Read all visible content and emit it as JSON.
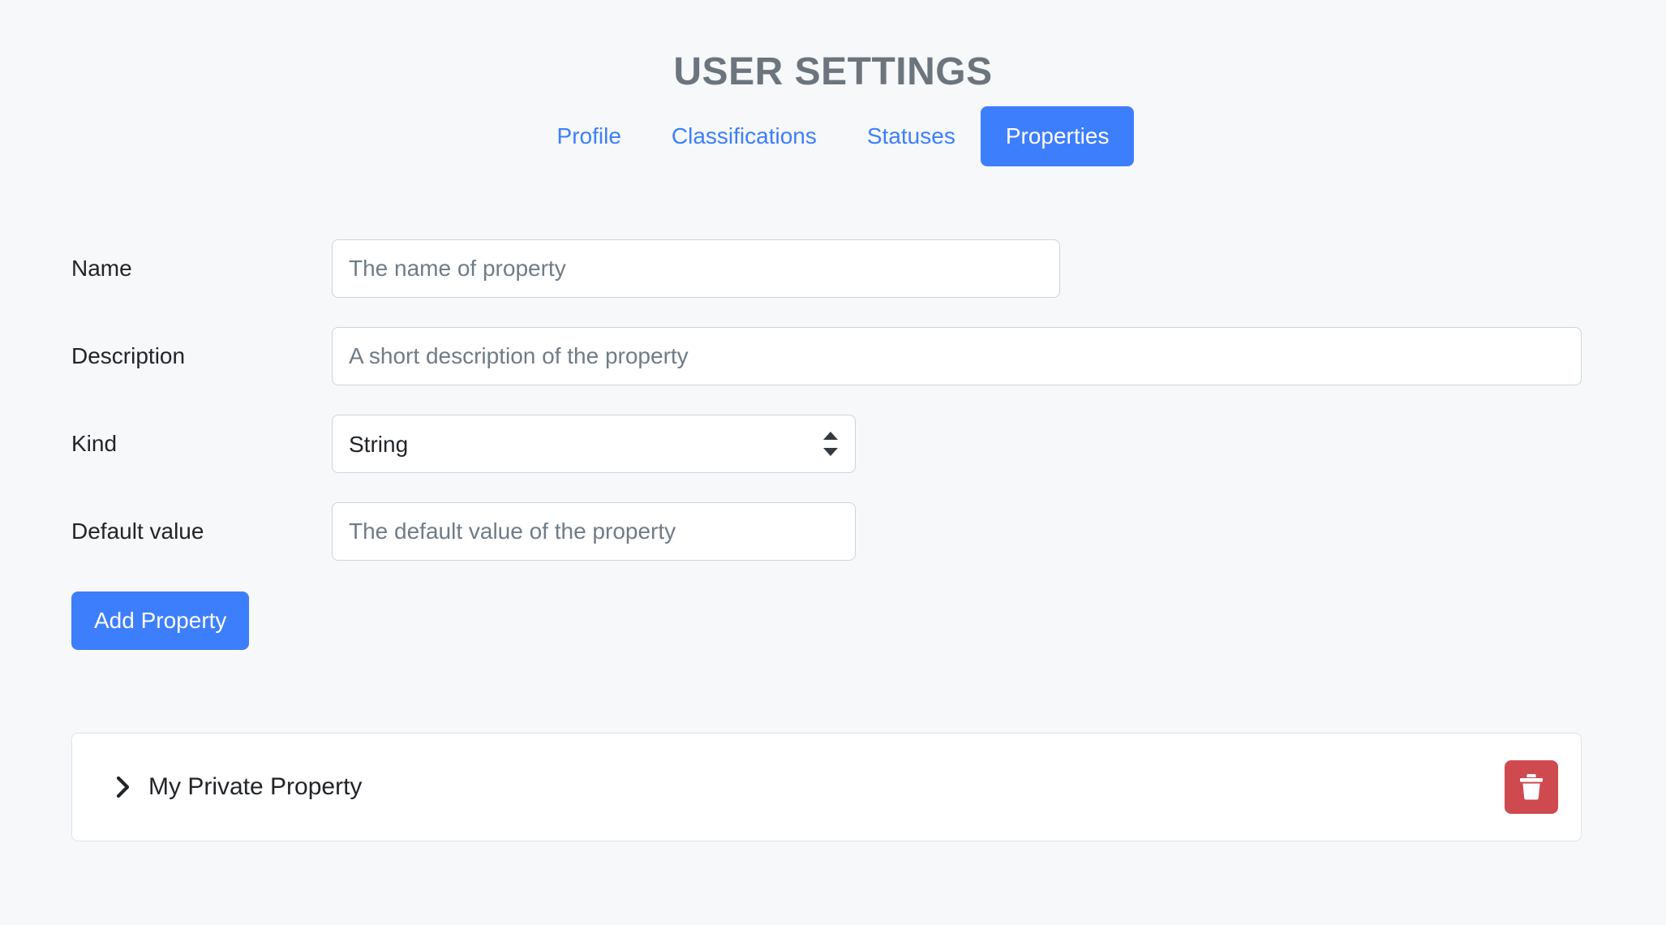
{
  "header": {
    "title": "USER SETTINGS"
  },
  "tabs": {
    "items": [
      {
        "label": "Profile",
        "active": false
      },
      {
        "label": "Classifications",
        "active": false
      },
      {
        "label": "Statuses",
        "active": false
      },
      {
        "label": "Properties",
        "active": true
      }
    ]
  },
  "form": {
    "name": {
      "label": "Name",
      "value": "",
      "placeholder": "The name of property"
    },
    "description": {
      "label": "Description",
      "value": "",
      "placeholder": "A short description of the property"
    },
    "kind": {
      "label": "Kind",
      "selected": "String",
      "options": [
        "String"
      ]
    },
    "default_value": {
      "label": "Default value",
      "value": "",
      "placeholder": "The default value of the property"
    },
    "submit_label": "Add Property"
  },
  "property_list": {
    "items": [
      {
        "name": "My Private Property",
        "expanded": false,
        "chevron": "chevron-right-icon",
        "delete_icon": "trash-icon"
      }
    ]
  },
  "colors": {
    "background": "#f6f8fa",
    "accent": "#3d7efc",
    "title": "#6c757d",
    "danger": "#cf4a4e",
    "text": "#212529",
    "placeholder": "#6f7c87",
    "border": "#ced4da",
    "card_border": "#dee2e6",
    "card_background": "#ffffff"
  }
}
